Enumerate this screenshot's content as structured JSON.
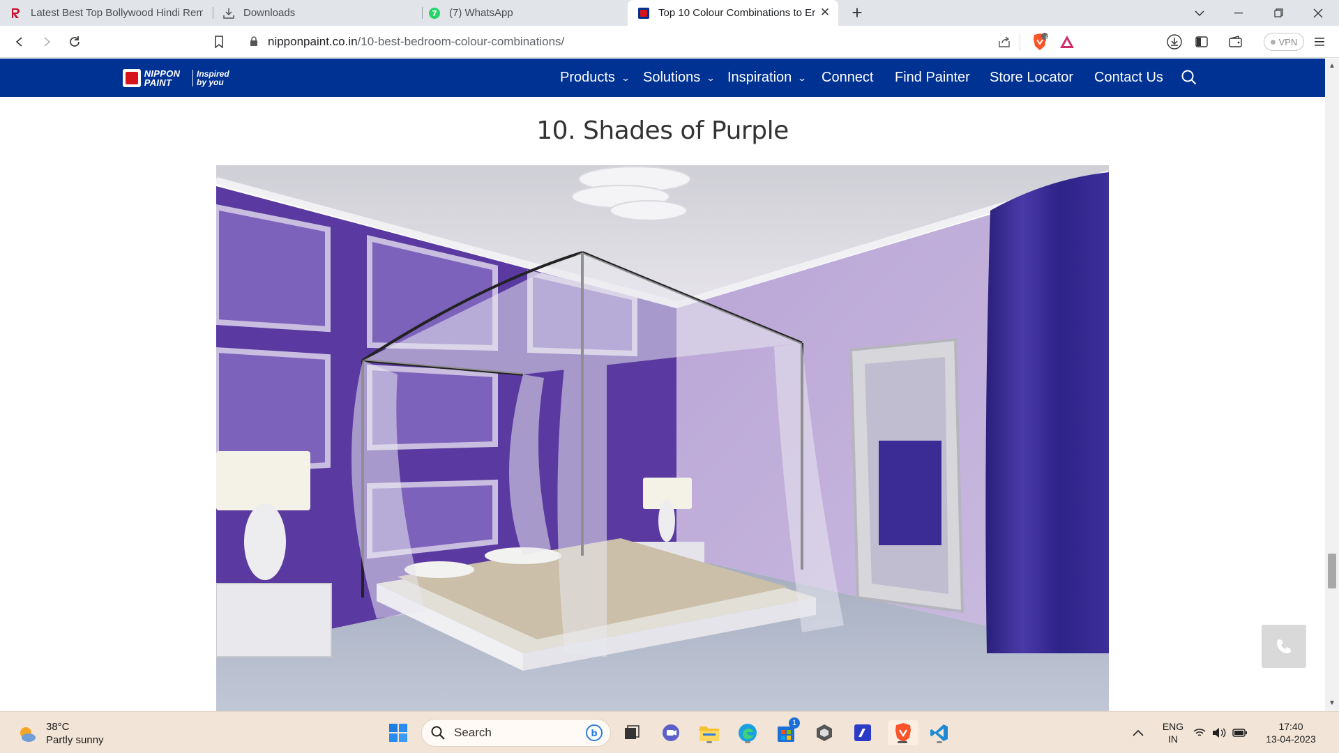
{
  "browser": {
    "tabs": [
      {
        "title": "Latest Best Top Bollywood Hindi Remi",
        "icon": "r-logo-icon",
        "active": false
      },
      {
        "title": "Downloads",
        "icon": "download-icon",
        "active": false
      },
      {
        "title": "(7) WhatsApp",
        "icon": "whatsapp-icon",
        "active": false
      },
      {
        "title": "Top 10 Colour Combinations to Er",
        "icon": "nippon-favicon-icon",
        "active": true
      }
    ],
    "url_domain": "nipponpaint.co.in",
    "url_path": "/10-best-bedroom-colour-combinations/",
    "vpn_label": "VPN",
    "shields_count": "6"
  },
  "site": {
    "logo_brand": "NIPPON PAINT",
    "logo_tagline": "Inspired by you",
    "nav": [
      {
        "label": "Products",
        "has_dropdown": true
      },
      {
        "label": "Solutions",
        "has_dropdown": true
      },
      {
        "label": "Inspiration",
        "has_dropdown": true
      },
      {
        "label": "Connect",
        "has_dropdown": false
      },
      {
        "label": "Find Painter",
        "has_dropdown": false
      },
      {
        "label": "Store Locator",
        "has_dropdown": false
      },
      {
        "label": "Contact Us",
        "has_dropdown": false
      }
    ],
    "accent_color": "#003293"
  },
  "content": {
    "heading": "10. Shades of Purple"
  },
  "taskbar": {
    "weather_temp": "38°C",
    "weather_desc": "Partly sunny",
    "search_label": "Search",
    "store_badge": "1",
    "lang_top": "ENG",
    "lang_bottom": "IN",
    "time": "17:40",
    "date": "13-04-2023"
  }
}
